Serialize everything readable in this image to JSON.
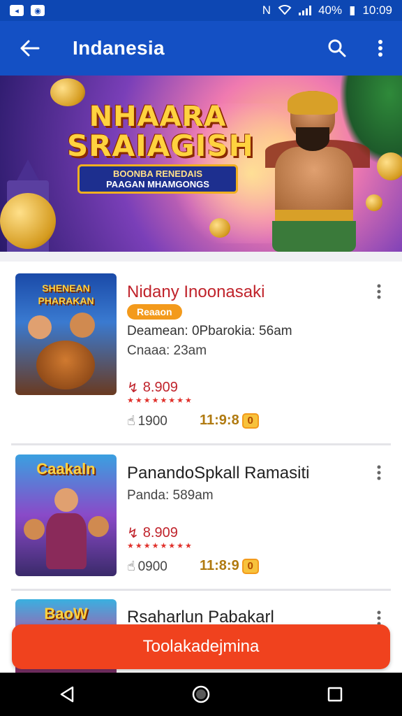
{
  "status_bar": {
    "nfc": "N",
    "battery": "40%",
    "time": "10:09"
  },
  "app_bar": {
    "title": "Indanesia",
    "icons": [
      "back-arrow-icon",
      "search-icon",
      "more-vert-icon"
    ]
  },
  "banner": {
    "logo_line1": "NHAARA",
    "logo_line2": "SRAIAGISH",
    "plate_line1": "BOONBA RENEDAIS",
    "plate_line2": "PAAGAN MHAMGONGS"
  },
  "items": [
    {
      "thumb_title": "SHENEAN PHARAKAN",
      "name": "Nidany Inoonasaki",
      "badge": "Reaaon",
      "meta1": "Deamean: 0Pbarokia: 56am",
      "meta2": "Cnaaa: 23am",
      "price": "8.909",
      "stars": "★★★★★★★★",
      "likes": "1900",
      "rating": "11:9:8",
      "rating_box": "0"
    },
    {
      "thumb_title": "Caakaln",
      "name": "PanandoSpkall Ramasiti",
      "meta1": "Panda: 589am",
      "price": "8.909",
      "stars": "★★★★★★★★",
      "likes": "0900",
      "rating": "11:8:9",
      "rating_box": "0"
    },
    {
      "thumb_title": "BaoW",
      "name": "Rsaharlun Pabakarl"
    }
  ],
  "cta": {
    "label": "Toolakadejmina"
  },
  "colors": {
    "app_bar": "#1450c4",
    "cta": "#f0421e",
    "badge": "#f39a1c",
    "price": "#c0232b"
  }
}
